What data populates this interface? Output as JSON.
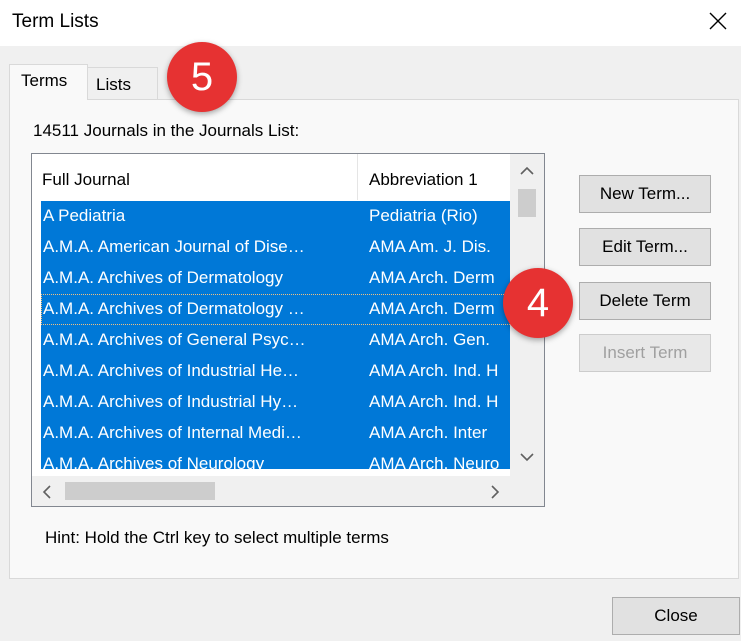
{
  "window": {
    "title": "Term Lists"
  },
  "tabs": [
    {
      "label": "Terms"
    },
    {
      "label": "Lists"
    }
  ],
  "list_count_label": "14511 Journals in the Journals List:",
  "table": {
    "columns": [
      "Full Journal",
      "Abbreviation 1"
    ],
    "rows": [
      {
        "full": "A Pediatria",
        "abbr": "Pediatria (Rio)"
      },
      {
        "full": "A.M.A. American Journal of Dise…",
        "abbr": "AMA Am. J. Dis."
      },
      {
        "full": "A.M.A. Archives of Dermatology",
        "abbr": "AMA Arch. Derm"
      },
      {
        "full": "A.M.A. Archives of Dermatology …",
        "abbr": "AMA Arch. Derm"
      },
      {
        "full": "A.M.A. Archives of General Psyc…",
        "abbr": "AMA Arch. Gen."
      },
      {
        "full": "A.M.A. Archives of Industrial He…",
        "abbr": "AMA Arch. Ind. H"
      },
      {
        "full": "A.M.A. Archives of Industrial Hy…",
        "abbr": "AMA Arch. Ind. H"
      },
      {
        "full": "A.M.A. Archives of Internal Medi…",
        "abbr": "AMA Arch. Inter"
      },
      {
        "full": "A.M.A. Archives of Neurology",
        "abbr": "AMA Arch. Neuro"
      }
    ]
  },
  "buttons": {
    "new_term": "New Term...",
    "edit_term": "Edit Term...",
    "delete_term": "Delete Term",
    "insert_term": "Insert Term",
    "close": "Close"
  },
  "hint": "Hint: Hold the Ctrl key to select multiple terms",
  "annotations": {
    "badge_tabs": "5",
    "badge_delete": "4"
  },
  "colors": {
    "selection": "#0078d7",
    "badge": "#e63232"
  },
  "icons": [
    "close-icon",
    "scroll-up-icon",
    "scroll-down-icon",
    "scroll-left-icon",
    "scroll-right-icon"
  ]
}
